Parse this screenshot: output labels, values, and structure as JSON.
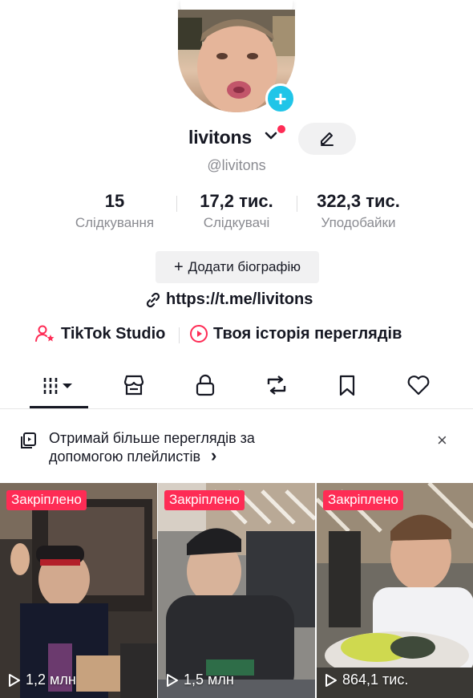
{
  "profile": {
    "username": "livitons",
    "handle": "@livitons",
    "add_symbol": "+"
  },
  "stats": [
    {
      "value": "15",
      "label": "Слідкування"
    },
    {
      "value": "17,2 тис.",
      "label": "Слідкувачі"
    },
    {
      "value": "322,3 тис.",
      "label": "Уподобайки"
    }
  ],
  "bio_button": {
    "plus": "+",
    "label": "Додати біографію"
  },
  "link": "https://t.me/livitons",
  "quick_links": {
    "studio": "TikTok Studio",
    "history": "Твоя історія переглядів"
  },
  "tabs": [
    {
      "icon": "grid-icon",
      "active": true
    },
    {
      "icon": "shop-icon",
      "active": false
    },
    {
      "icon": "lock-icon",
      "active": false
    },
    {
      "icon": "repost-icon",
      "active": false
    },
    {
      "icon": "bookmark-icon",
      "active": false
    },
    {
      "icon": "heart-icon",
      "active": false
    }
  ],
  "banner": {
    "text": "Отримай більше переглядів за допомогою плейлистів",
    "chevron": "›",
    "close": "×"
  },
  "videos": [
    {
      "pinned_label": "Закріплено",
      "views": "1,2 млн"
    },
    {
      "pinned_label": "Закріплено",
      "views": "1,5 млн"
    },
    {
      "pinned_label": "Закріплено",
      "views": "864,1 тис."
    }
  ],
  "colors": {
    "accent": "#fe2c55",
    "add_badge": "#20c5e8",
    "text": "#161823",
    "secondary": "#8a8b91"
  }
}
